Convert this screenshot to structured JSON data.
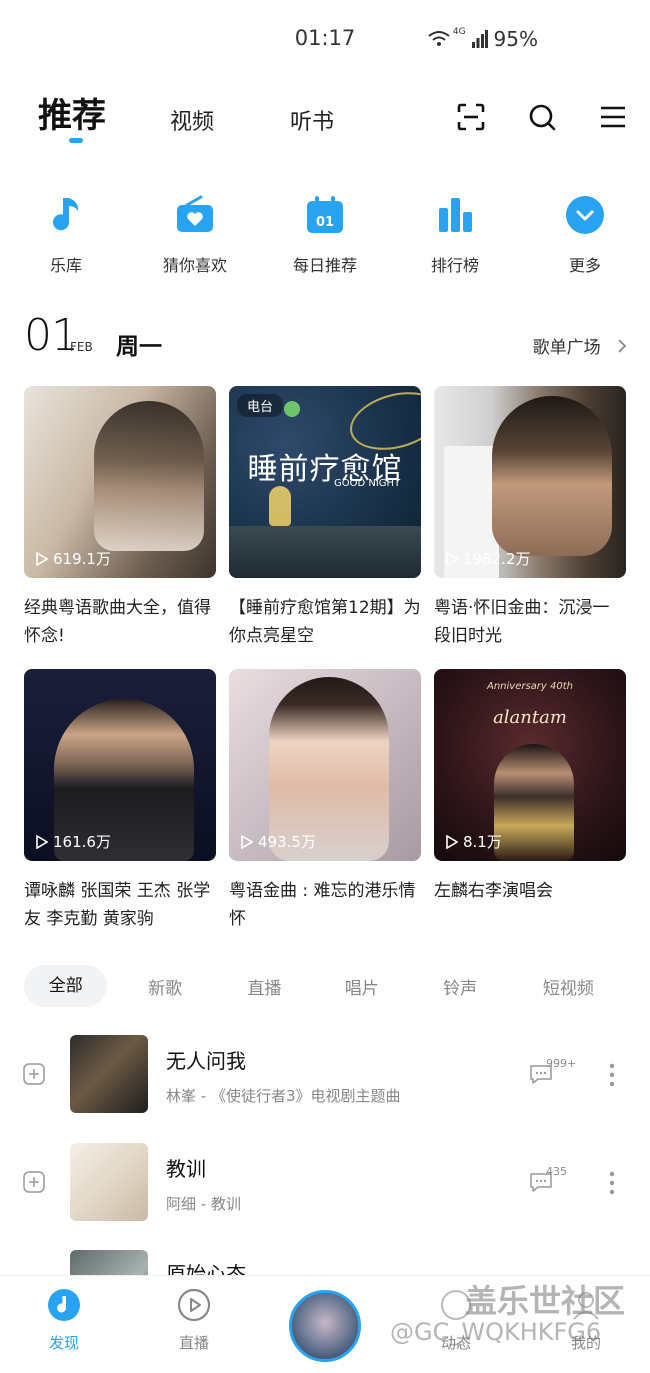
{
  "status": {
    "time": "01:17",
    "network": "4G",
    "battery": "95%"
  },
  "top_tabs": {
    "active": "推荐",
    "tab2": "视频",
    "tab3": "听书"
  },
  "quick": [
    {
      "label": "乐库",
      "icon": "music-note-icon"
    },
    {
      "label": "猜你喜欢",
      "icon": "radio-heart-icon"
    },
    {
      "label": "每日推荐",
      "icon": "calendar-icon",
      "badge": "01"
    },
    {
      "label": "排行榜",
      "icon": "chart-bars-icon"
    },
    {
      "label": "更多",
      "icon": "chevron-down-icon"
    }
  ],
  "date": {
    "day": "01",
    "month": "FEB",
    "weekday": "周一",
    "more": "歌单广场"
  },
  "cards": [
    {
      "title": "经典粤语歌曲大全，值得怀念!",
      "count": "619.1万",
      "badge": "",
      "cover_text": ""
    },
    {
      "title": "【睡前疗愈馆第12期】为你点亮星空",
      "count": "",
      "badge": "电台",
      "cover_text": "睡前疗愈馆",
      "cover_sub": "GOOD NIGHT"
    },
    {
      "title": "粤语·怀旧金曲：沉浸一段旧时光",
      "count": "1982.2万",
      "badge": "",
      "cover_text": ""
    },
    {
      "title": "谭咏麟 张国荣 王杰 张学友 李克勤 黄家驹",
      "count": "161.6万",
      "badge": "",
      "cover_text": ""
    },
    {
      "title": "粤语金曲 : 难忘的港乐情怀",
      "count": "493.5万",
      "badge": "",
      "cover_text": ""
    },
    {
      "title": "左麟右李演唱会",
      "count": "8.1万",
      "badge": "",
      "cover_text": "alantam",
      "cover_sub": "Anniversary 40th"
    }
  ],
  "filters": [
    "全部",
    "新歌",
    "直播",
    "唱片",
    "铃声",
    "短视频"
  ],
  "songs": [
    {
      "name": "无人问我",
      "meta": "林峯 - 《使徒行者3》电视剧主题曲",
      "comments": "999+"
    },
    {
      "name": "教训",
      "meta": "阿细 - 教训",
      "comments": "435"
    },
    {
      "name": "原始心态",
      "meta": "",
      "comments": ""
    }
  ],
  "bottom_nav": {
    "discover": "发现",
    "live": "直播",
    "dynamic": "动态",
    "mine": "我的"
  },
  "watermark": {
    "line1": "盖乐世社区",
    "line2": "@GC_WQKHKFG6"
  },
  "colors": {
    "accent": "#28a3f2"
  }
}
